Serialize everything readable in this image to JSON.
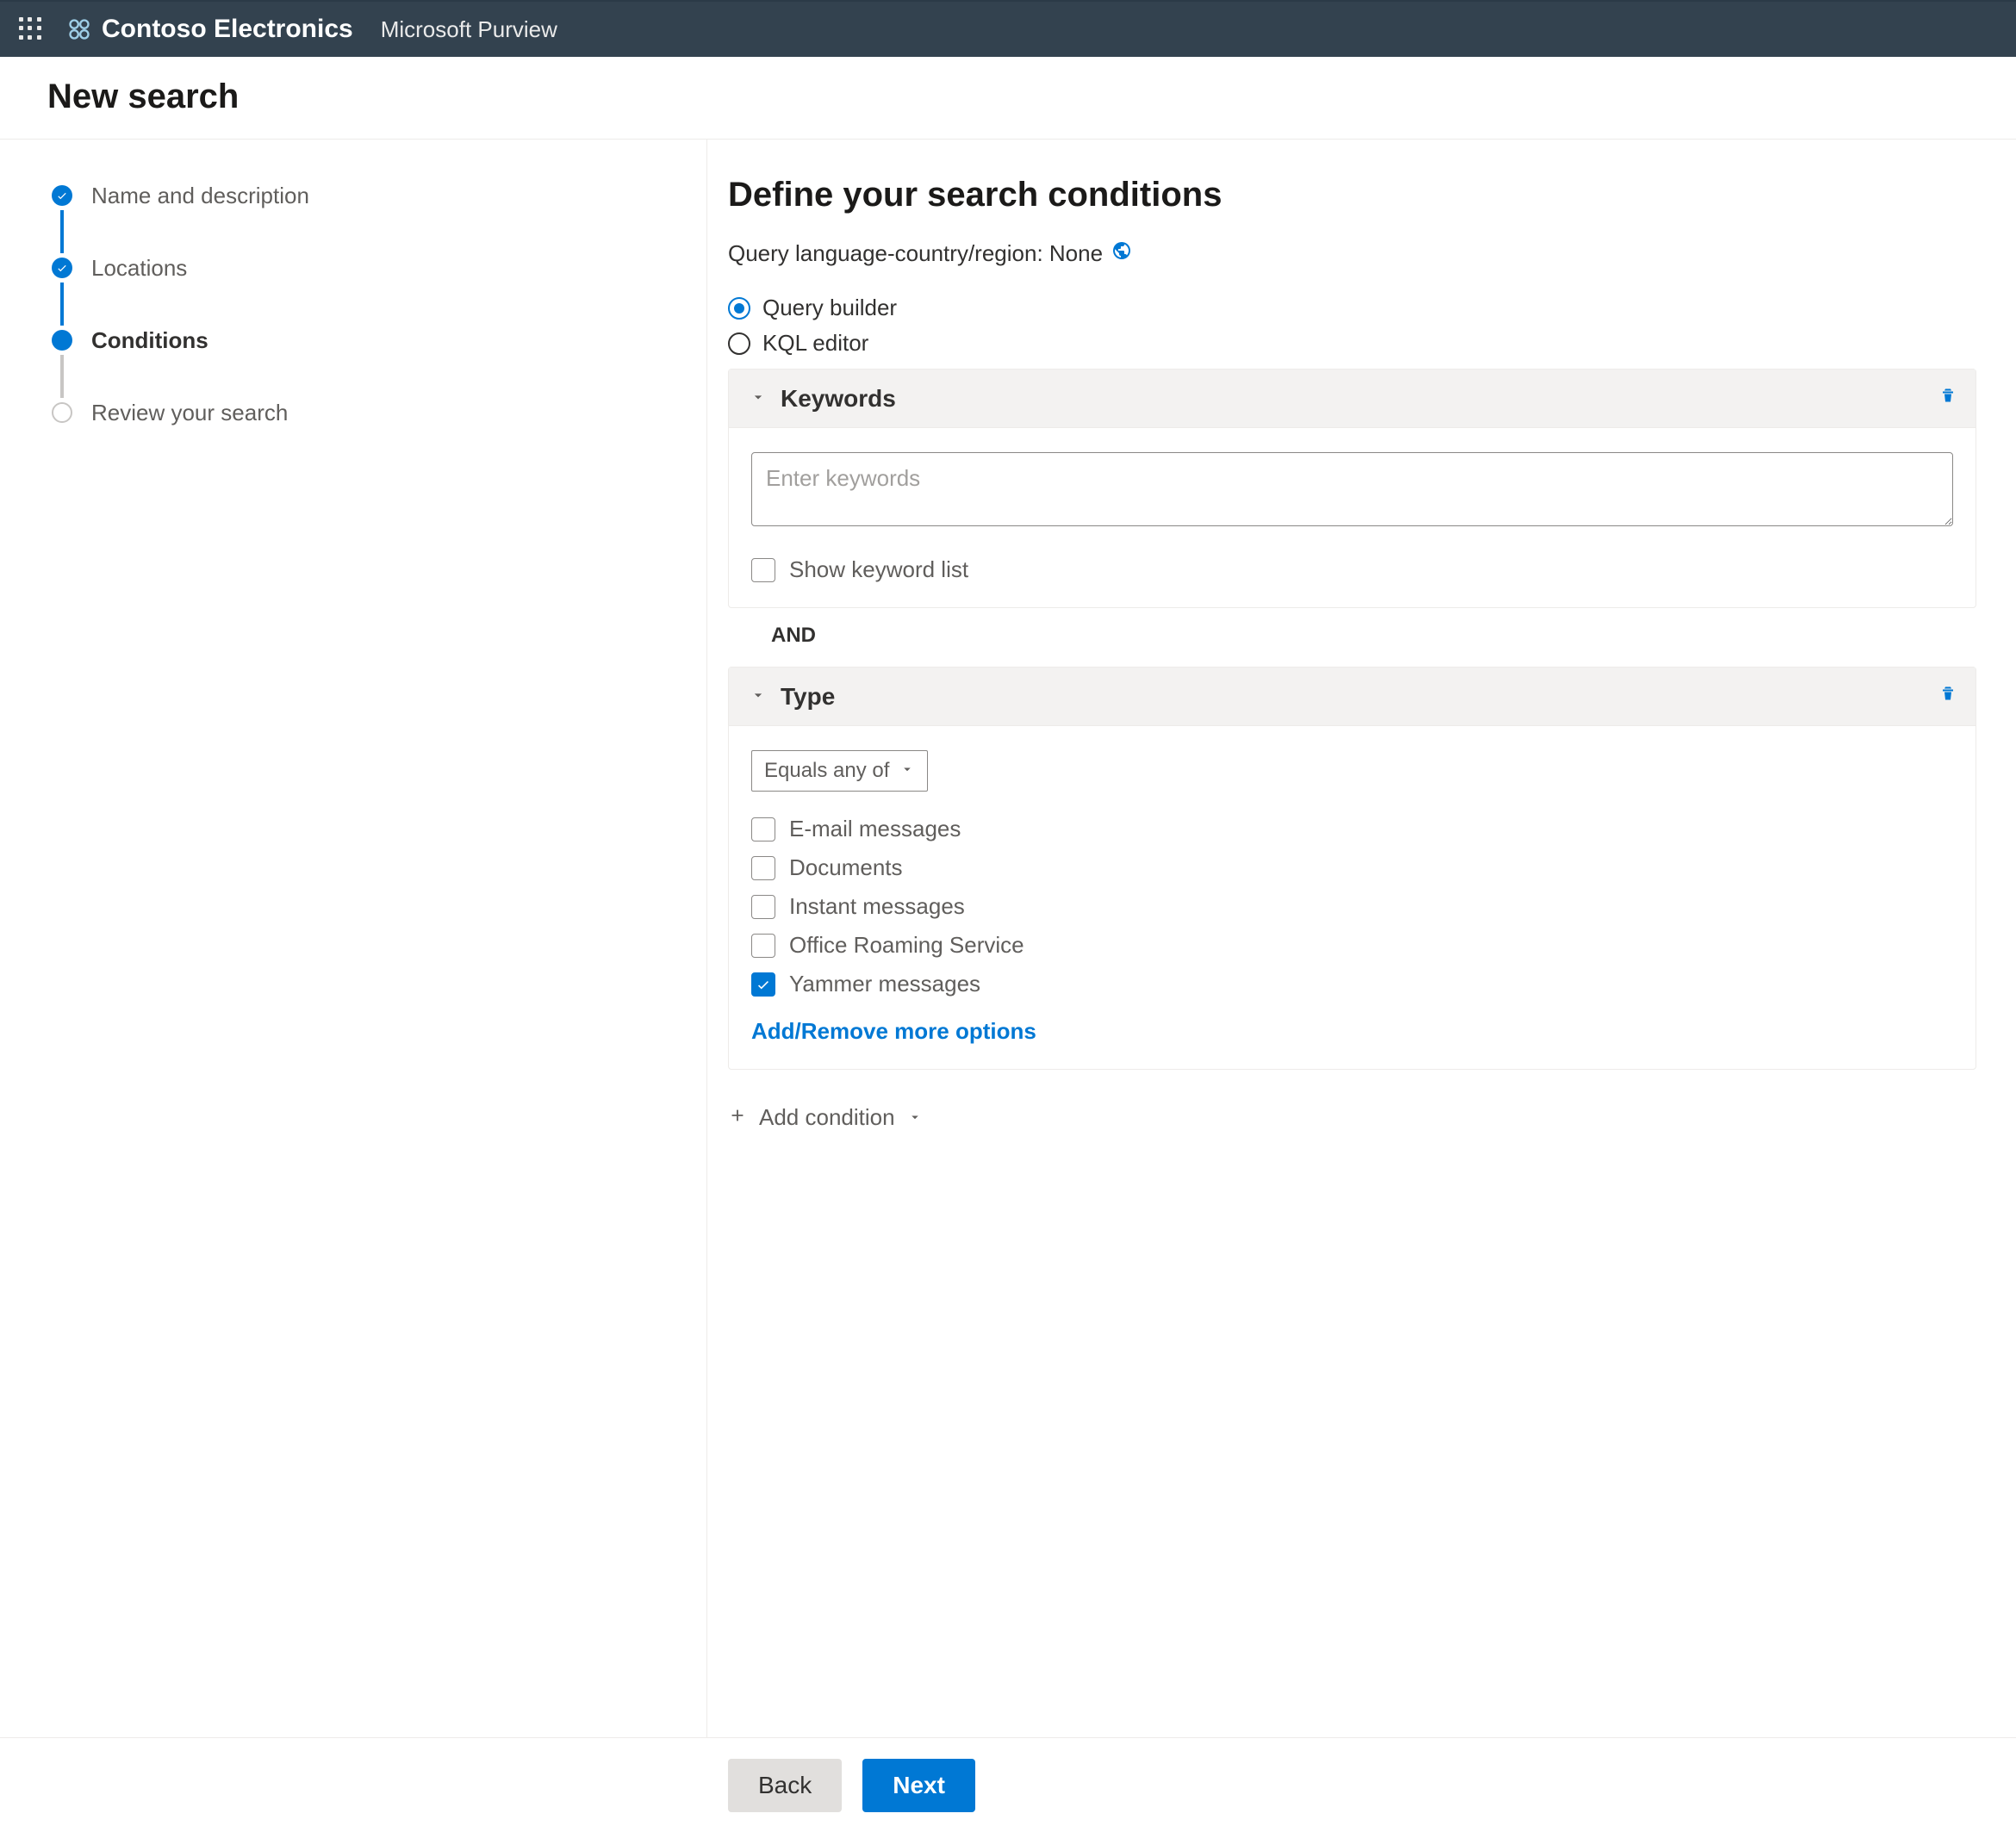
{
  "topbar": {
    "org": "Contoso Electronics",
    "product": "Microsoft Purview"
  },
  "page": {
    "title": "New search"
  },
  "steps": [
    {
      "label": "Name and description",
      "state": "complete"
    },
    {
      "label": "Locations",
      "state": "complete"
    },
    {
      "label": "Conditions",
      "state": "current"
    },
    {
      "label": "Review your search",
      "state": "upcoming"
    }
  ],
  "main": {
    "heading": "Define your search conditions",
    "query_lang_label": "Query language-country/region: None",
    "radios": {
      "builder": "Query builder",
      "kql": "KQL editor",
      "selected": "builder"
    },
    "keywords": {
      "section": "Keywords",
      "placeholder": "Enter keywords",
      "show_list_label": "Show keyword list",
      "show_list_checked": false
    },
    "operator": "AND",
    "type": {
      "section": "Type",
      "select_label": "Equals any of",
      "options": [
        {
          "label": "E-mail messages",
          "checked": false
        },
        {
          "label": "Documents",
          "checked": false
        },
        {
          "label": "Instant messages",
          "checked": false
        },
        {
          "label": "Office Roaming Service",
          "checked": false
        },
        {
          "label": "Yammer messages",
          "checked": true
        }
      ],
      "more_link": "Add/Remove more options"
    },
    "add_condition": "Add condition"
  },
  "footer": {
    "back": "Back",
    "next": "Next"
  }
}
